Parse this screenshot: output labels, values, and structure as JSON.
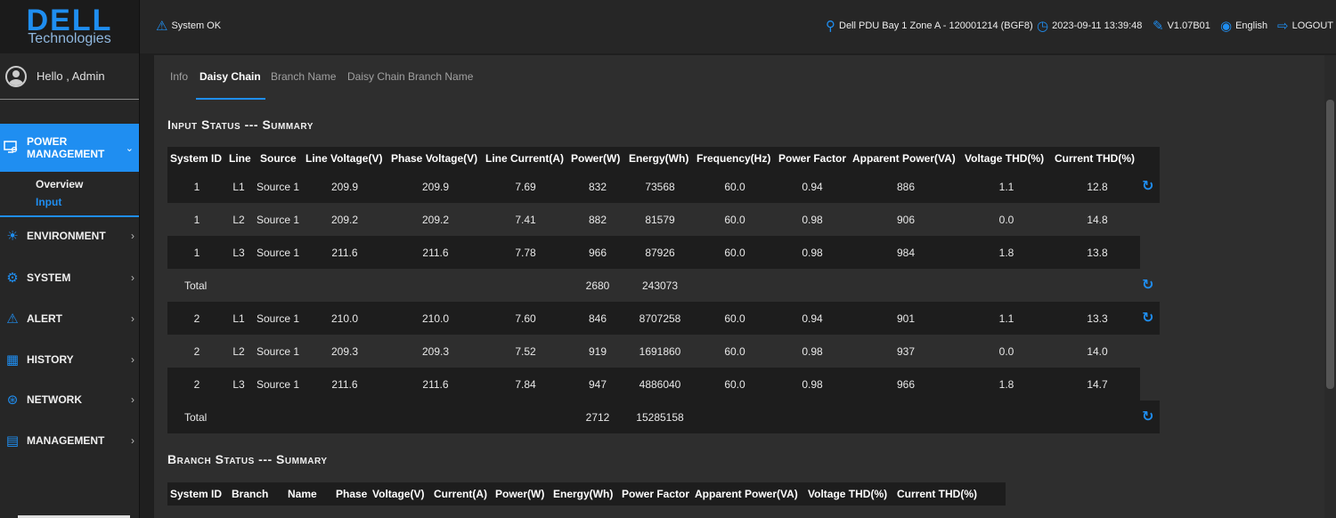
{
  "logo": {
    "brand": "DELL",
    "sub": "Technologies"
  },
  "user": {
    "greeting": "Hello , Admin"
  },
  "sidebar": {
    "active": {
      "label_line1": "POWER",
      "label_line2": "MANAGEMENT"
    },
    "sub": [
      "Overview",
      "Input"
    ],
    "items": [
      "ENVIRONMENT",
      "SYSTEM",
      "ALERT",
      "HISTORY",
      "NETWORK",
      "MANAGEMENT"
    ]
  },
  "topbar": {
    "status": "System OK",
    "device": "Dell PDU Bay 1 Zone A - 120001214 (BGF8)",
    "datetime": "2023-09-11 13:39:48",
    "version": "V1.07B01",
    "language": "English",
    "logout": "LOGOUT"
  },
  "tabs": [
    "Info",
    "Daisy Chain",
    "Branch Name",
    "Daisy Chain Branch Name"
  ],
  "input_status": {
    "title": "Input Status --- Summary",
    "headers": [
      "System ID",
      "Line",
      "Source",
      "Line Voltage(V)",
      "Phase Voltage(V)",
      "Line Current(A)",
      "Power(W)",
      "Energy(Wh)",
      "Frequency(Hz)",
      "Power Factor",
      "Apparent Power(VA)",
      "Voltage THD(%)",
      "Current THD(%)"
    ],
    "rows": [
      [
        "1",
        "L1",
        "Source 1",
        "209.9",
        "209.9",
        "7.69",
        "832",
        "73568",
        "60.0",
        "0.94",
        "886",
        "1.1",
        "12.8"
      ],
      [
        "1",
        "L2",
        "Source 1",
        "209.2",
        "209.2",
        "7.41",
        "882",
        "81579",
        "60.0",
        "0.98",
        "906",
        "0.0",
        "14.8"
      ],
      [
        "1",
        "L3",
        "Source 1",
        "211.6",
        "211.6",
        "7.78",
        "966",
        "87926",
        "60.0",
        "0.98",
        "984",
        "1.8",
        "13.8"
      ],
      [
        "2",
        "L1",
        "Source 1",
        "210.0",
        "210.0",
        "7.60",
        "846",
        "8707258",
        "60.0",
        "0.94",
        "901",
        "1.1",
        "13.3"
      ],
      [
        "2",
        "L2",
        "Source 1",
        "209.3",
        "209.3",
        "7.52",
        "919",
        "1691860",
        "60.0",
        "0.98",
        "937",
        "0.0",
        "14.0"
      ],
      [
        "2",
        "L3",
        "Source 1",
        "211.6",
        "211.6",
        "7.84",
        "947",
        "4886040",
        "60.0",
        "0.98",
        "966",
        "1.8",
        "14.7"
      ]
    ],
    "totals": [
      {
        "label": "Total",
        "power": "2680",
        "energy": "243073"
      },
      {
        "label": "Total",
        "power": "2712",
        "energy": "15285158"
      }
    ]
  },
  "branch_status": {
    "title": "Branch Status --- Summary",
    "headers": [
      "System ID",
      "Branch",
      "Name",
      "Phase",
      "Voltage(V)",
      "Current(A)",
      "Power(W)",
      "Energy(Wh)",
      "Power Factor",
      "Apparent Power(VA)",
      "Voltage THD(%)",
      "Current THD(%)"
    ]
  }
}
